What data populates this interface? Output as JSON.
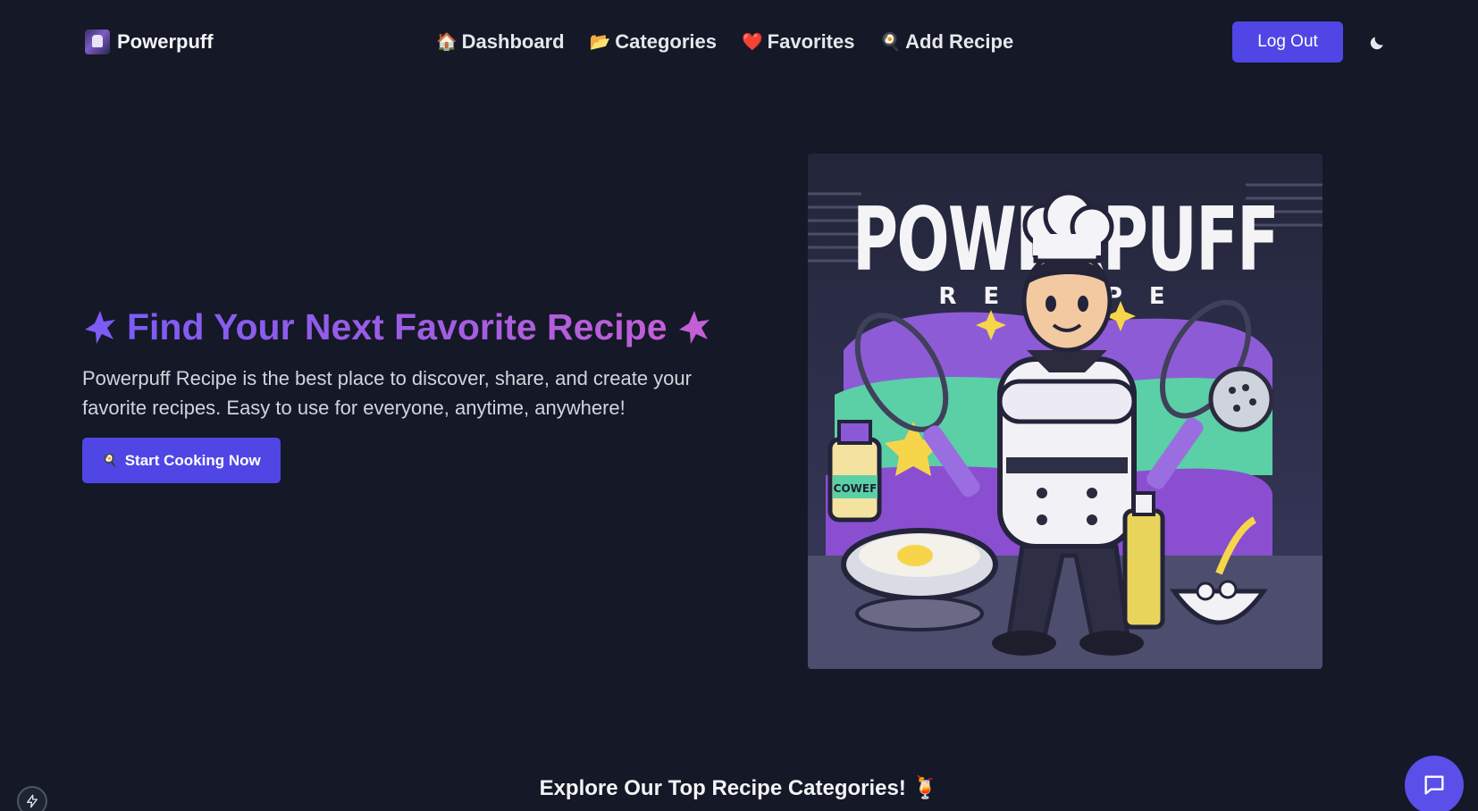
{
  "brand": {
    "name": "Powerpuff",
    "logo_icon": "powerpuff-logo-icon"
  },
  "nav": {
    "items": [
      {
        "emoji": "🏠",
        "label": "Dashboard"
      },
      {
        "emoji": "📂",
        "label": "Categories"
      },
      {
        "emoji": "❤️",
        "label": "Favorites"
      },
      {
        "emoji": "🍳",
        "label": "Add Recipe"
      }
    ],
    "logout_label": "Log Out",
    "theme_icon": "moon-icon"
  },
  "hero": {
    "title_left_icon": "sparkle-star-icon",
    "title": "Find Your Next Favorite Recipe",
    "title_right_icon": "sparkle-star-icon",
    "description": "Powerpuff Recipe is the best place to discover, share, and create your favorite recipes. Easy to use for everyone, anytime, anywhere!",
    "cta_emoji": "🍳",
    "cta_label": "Start Cooking Now",
    "image_text_main": "POWERPUFF",
    "image_text_sub": "RECIPE",
    "image_text_bottle": "COWEF"
  },
  "section": {
    "heading": "Explore Our Top Recipe Categories! 🍹"
  },
  "floating": {
    "bolt_icon": "lightning-bolt-icon",
    "chat_icon": "chat-bubble-icon"
  },
  "colors": {
    "background": "#141827",
    "accent": "#4f46e5",
    "gradient_start": "#7c5cf5",
    "gradient_end": "#c25fd6"
  }
}
